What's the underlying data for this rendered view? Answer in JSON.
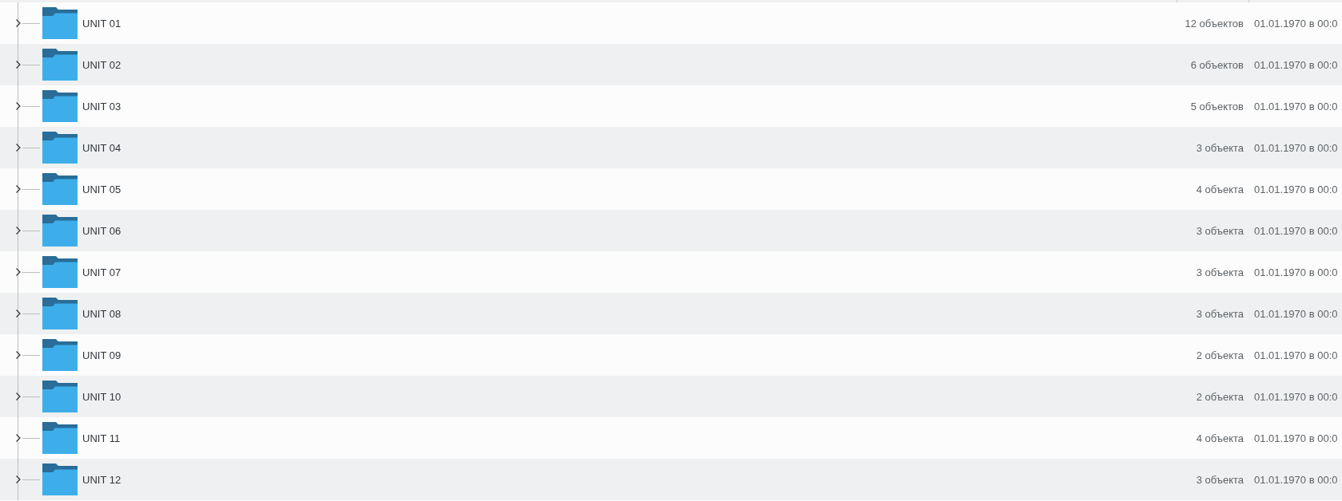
{
  "rows": [
    {
      "name": "UNIT 01",
      "size": "12 объектов",
      "modified": "01.01.1970 в 00:0",
      "expanded": false
    },
    {
      "name": "UNIT 02",
      "size": "6 объектов",
      "modified": "01.01.1970 в 00:0",
      "expanded": false
    },
    {
      "name": "UNIT 03",
      "size": "5 объектов",
      "modified": "01.01.1970 в 00:0",
      "expanded": false
    },
    {
      "name": "UNIT 04",
      "size": "3 объекта",
      "modified": "01.01.1970 в 00:0",
      "expanded": false
    },
    {
      "name": "UNIT 05",
      "size": "4 объекта",
      "modified": "01.01.1970 в 00:0",
      "expanded": false
    },
    {
      "name": "UNIT 06",
      "size": "3 объекта",
      "modified": "01.01.1970 в 00:0",
      "expanded": false
    },
    {
      "name": "UNIT 07",
      "size": "3 объекта",
      "modified": "01.01.1970 в 00:0",
      "expanded": false
    },
    {
      "name": "UNIT 08",
      "size": "3 объекта",
      "modified": "01.01.1970 в 00:0",
      "expanded": false
    },
    {
      "name": "UNIT 09",
      "size": "2 объекта",
      "modified": "01.01.1970 в 00:0",
      "expanded": false
    },
    {
      "name": "UNIT 10",
      "size": "2 объекта",
      "modified": "01.01.1970 в 00:0",
      "expanded": false
    },
    {
      "name": "UNIT 11",
      "size": "4 объекта",
      "modified": "01.01.1970 в 00:0",
      "expanded": false
    },
    {
      "name": "UNIT 12",
      "size": "3 объекта",
      "modified": "01.01.1970 в 00:0",
      "expanded": false
    }
  ]
}
